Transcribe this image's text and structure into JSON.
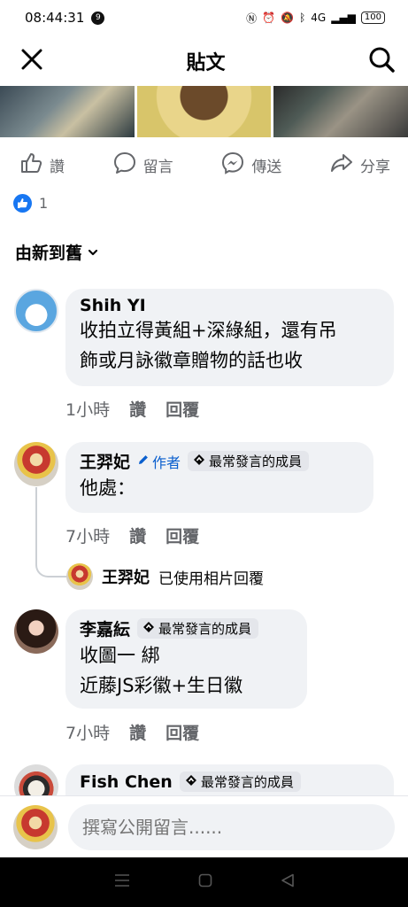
{
  "status": {
    "time": "08:44:31",
    "notif_count": "9",
    "network": "4G",
    "battery": "100"
  },
  "header": {
    "title": "貼文"
  },
  "actions": {
    "like": "讚",
    "comment": "留言",
    "share_messenger": "傳送",
    "share": "分享"
  },
  "reactions": {
    "count": "1"
  },
  "sort": {
    "label": "由新到舊"
  },
  "comments": [
    {
      "author": "Shih YI",
      "badge": "",
      "author_tag": "",
      "text": "收拍立得黃組+深綠組，還有吊\n飾或月詠徽章贈物的話也收",
      "time": "1小時",
      "like": "讚",
      "reply": "回覆"
    },
    {
      "author": "王羿妃",
      "author_tag": "作者",
      "badge": "最常發言的成員",
      "text": "他處：",
      "time": "7小時",
      "like": "讚",
      "reply": "回覆"
    },
    {
      "author": "李嘉紜",
      "author_tag": "",
      "badge": "最常發言的成員",
      "text": "收圖一 綁\n近藤JS彩徽+生日徽",
      "time": "7小時",
      "like": "讚",
      "reply": "回覆"
    },
    {
      "author": "Fish Chen",
      "author_tag": "",
      "badge": "最常發言的成員",
      "text": "",
      "time": "",
      "like": "",
      "reply": ""
    }
  ],
  "reply_preview": {
    "name": "王羿妃",
    "text": "已使用相片回覆"
  },
  "composer": {
    "placeholder": "撰寫公開留言......"
  },
  "colors": {
    "accent": "#1877f2",
    "author_tag": "#0a5fce",
    "bubble": "#f0f2f5",
    "meta": "#65676b"
  }
}
